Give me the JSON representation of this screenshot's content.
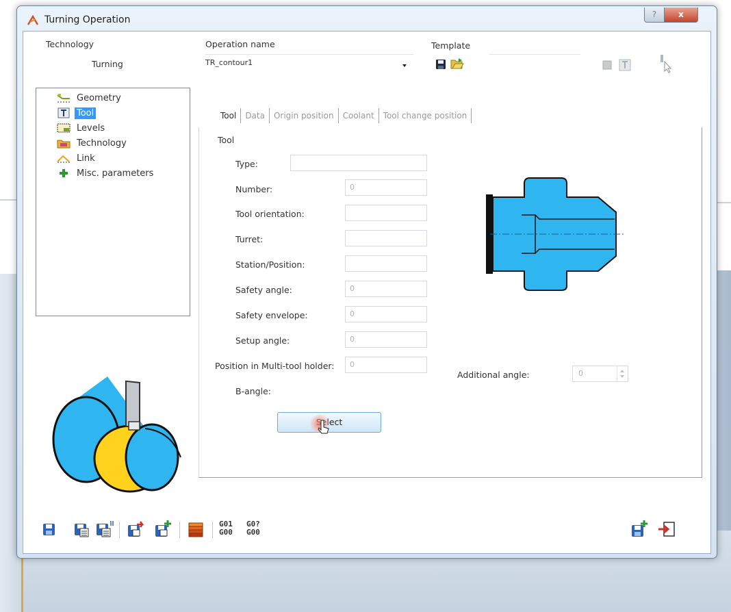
{
  "window": {
    "title": "Turning Operation",
    "help_label": "?",
    "close_label": "x"
  },
  "header": {
    "technology_label": "Technology",
    "technology_value": "Turning",
    "operation_name_label": "Operation name",
    "operation_name_value": "TR_contour1",
    "template_label": "Template"
  },
  "tree": {
    "items": [
      {
        "label": "Geometry",
        "icon": "geometry-icon"
      },
      {
        "label": "Tool",
        "icon": "tool-icon",
        "selected": true
      },
      {
        "label": "Levels",
        "icon": "levels-icon"
      },
      {
        "label": "Technology",
        "icon": "technology-icon"
      },
      {
        "label": "Link",
        "icon": "link-icon"
      },
      {
        "label": "Misc. parameters",
        "icon": "plus-icon"
      }
    ]
  },
  "tabs": [
    {
      "label": "Tool",
      "active": true
    },
    {
      "label": "Data"
    },
    {
      "label": "Origin position"
    },
    {
      "label": "Coolant"
    },
    {
      "label": "Tool change position"
    }
  ],
  "tool_panel": {
    "group_label": "Tool",
    "fields": [
      {
        "label": "Type:",
        "value": ""
      },
      {
        "label": "Number:",
        "value": "0"
      },
      {
        "label": "Tool orientation:",
        "value": ""
      },
      {
        "label": "Turret:",
        "value": ""
      },
      {
        "label": "Station/Position:",
        "value": ""
      },
      {
        "label": "Safety angle:",
        "value": "0"
      },
      {
        "label": "Safety envelope:",
        "value": "0"
      },
      {
        "label": "Setup angle:",
        "value": "0"
      },
      {
        "label": "Position in Multi-tool holder:",
        "value": "0"
      },
      {
        "label": "B-angle:",
        "value": ""
      }
    ],
    "additional_angle_label": "Additional angle:",
    "additional_angle_value": "0",
    "select_button_label": "Select"
  },
  "bottom_toolbar": {
    "gcode_1": {
      "top": "G01",
      "bottom": "G00"
    },
    "gcode_2": {
      "top": "G0?",
      "bottom": "G00"
    }
  },
  "colors": {
    "accent_blue": "#3399ff",
    "part_blue": "#2fb6f0",
    "part_yellow": "#ffd21e",
    "close_red": "#c3442c"
  }
}
